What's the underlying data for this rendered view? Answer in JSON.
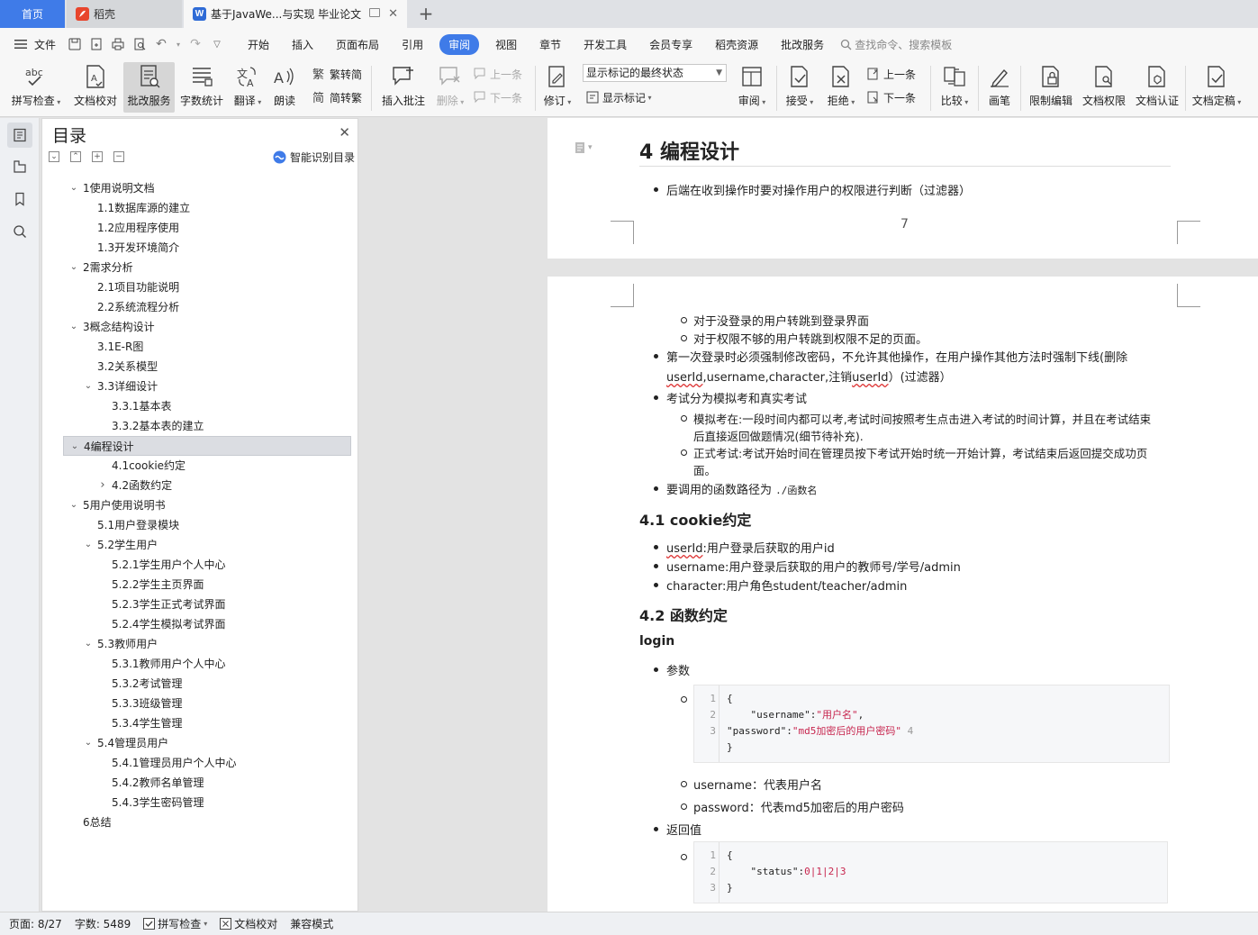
{
  "tabs": {
    "home": "首页",
    "daoke": "稻壳",
    "doc": "基于JavaWe...与实现 毕业论文"
  },
  "menu": [
    "开始",
    "插入",
    "页面布局",
    "引用",
    "审阅",
    "视图",
    "章节",
    "开发工具",
    "会员专享",
    "稻壳资源",
    "批改服务"
  ],
  "menu_active_index": 4,
  "file_label": "文件",
  "search_placeholder": "查找命令、搜索模板",
  "ribbon": {
    "spell": "拼写检查",
    "proof": "文档校对",
    "correct": "批改服务",
    "wordcount": "字数统计",
    "translate": "翻译",
    "read": "朗读",
    "trad": "繁转简",
    "simp": "简转繁",
    "insert_comment": "插入批注",
    "delete": "删除",
    "prev": "上一条",
    "next": "下一条",
    "revise": "修订",
    "markup_select": "显示标记的最终状态",
    "show_markup": "显示标记",
    "review": "审阅",
    "accept": "接受",
    "reject": "拒绝",
    "prev2": "上一条",
    "next2": "下一条",
    "compare": "比较",
    "pen": "画笔",
    "restrict": "限制编辑",
    "perm": "文档权限",
    "auth": "文档认证",
    "final": "文档定稿"
  },
  "toc": {
    "title": "目录",
    "smart": "智能识别目录",
    "items": [
      {
        "label": "1使用说明文档",
        "level": 1,
        "caret": "down"
      },
      {
        "label": "1.1数据库源的建立",
        "level": 2
      },
      {
        "label": "1.2应用程序使用",
        "level": 2
      },
      {
        "label": "1.3开发环境简介",
        "level": 2
      },
      {
        "label": "2需求分析",
        "level": 1,
        "caret": "down"
      },
      {
        "label": "2.1项目功能说明",
        "level": 2
      },
      {
        "label": "2.2系统流程分析",
        "level": 2
      },
      {
        "label": "3概念结构设计",
        "level": 1,
        "caret": "down"
      },
      {
        "label": "3.1E-R图",
        "level": 2
      },
      {
        "label": "3.2关系模型",
        "level": 2
      },
      {
        "label": "3.3详细设计",
        "level": 2,
        "caret": "down"
      },
      {
        "label": "3.3.1基本表",
        "level": 3
      },
      {
        "label": "3.3.2基本表的建立",
        "level": 3
      },
      {
        "label": "4编程设计",
        "level": 1,
        "caret": "down",
        "selected": true
      },
      {
        "label": "4.1cookie约定",
        "level": 3
      },
      {
        "label": "4.2函数约定",
        "level": 3,
        "caret": "right"
      },
      {
        "label": "5用户使用说明书",
        "level": 1,
        "caret": "down"
      },
      {
        "label": "5.1用户登录模块",
        "level": 2
      },
      {
        "label": "5.2学生用户",
        "level": 2,
        "caret": "down"
      },
      {
        "label": "5.2.1学生用户个人中心",
        "level": 3
      },
      {
        "label": "5.2.2学生主页界面",
        "level": 3
      },
      {
        "label": "5.2.3学生正式考试界面",
        "level": 3
      },
      {
        "label": "5.2.4学生模拟考试界面",
        "level": 3
      },
      {
        "label": "5.3教师用户",
        "level": 2,
        "caret": "down"
      },
      {
        "label": "5.3.1教师用户个人中心",
        "level": 3
      },
      {
        "label": "5.3.2考试管理",
        "level": 3
      },
      {
        "label": "5.3.3班级管理",
        "level": 3
      },
      {
        "label": "5.3.4学生管理",
        "level": 3
      },
      {
        "label": "5.4管理员用户",
        "level": 2,
        "caret": "down"
      },
      {
        "label": "5.4.1管理员用户个人中心",
        "level": 3
      },
      {
        "label": "5.4.2教师名单管理",
        "level": 3
      },
      {
        "label": "5.4.3学生密码管理",
        "level": 3
      },
      {
        "label": "6总结",
        "level": 1
      }
    ]
  },
  "page1": {
    "heading": "4 编程设计",
    "bullet": "后端在收到操作时要对操作用户的权限进行判断（过滤器）",
    "page_number": "7"
  },
  "page2": {
    "sub1": "对于没登录的用户转跳到登录界面",
    "sub2": "对于权限不够的用户转跳到权限不足的页面。",
    "b1_line1": "第一次登录时必须强制修改密码，不允许其他操作，在用户操作其他方法时强制下线(删除",
    "b1_l2_a": "userId",
    "b1_l2_b": ",username,character,注销",
    "b1_l2_c": "userId",
    "b1_l2_d": "）(过滤器）",
    "b2": "考试分为模拟考和真实考试",
    "b2_s1_l1": "模拟考在:一段时间内都可以考,考试时间按照考生点击进入考试的时间计算，并且在考试结束",
    "b2_s1_l2": "后直接返回做题情况(细节待补充).",
    "b2_s2_l1": "正式考试:考试开始时间在管理员按下考试开始时统一开始计算，考试结束后返回提交成功页",
    "b2_s2_l2": "面。",
    "b3_text": "要调用的函数路径为",
    "b3_code": "./函数名",
    "h41": "4.1 cookie约定",
    "c1_a": "userId",
    "c1_b": ":用户登录后获取的用户id",
    "c2": "username:用户登录后获取的用户的教师号/学号/admin",
    "c3": "character:用户角色student/teacher/admin",
    "h42": "4.2 函数约定",
    "login": "login",
    "param": "参数",
    "code1": [
      {
        "n": "1",
        "t": "{"
      },
      {
        "n": "2",
        "k": "    \"username\"",
        "s": "\"用户名\"",
        "e": ","
      },
      {
        "n": "3",
        "k": "\"password\"",
        "s": "\"md5加密后的用户密码\"",
        "e": " 4"
      },
      {
        "n": "",
        "t": "}"
      }
    ],
    "p1": "username：代表用户名",
    "p2": "password：代表md5加密后的用户密码",
    "ret": "返回值",
    "code2": [
      {
        "n": "1",
        "t": "{"
      },
      {
        "n": "2",
        "k": "    \"status\"",
        "s": "0|1|2|3",
        "e": ""
      },
      {
        "n": "3",
        "t": "}"
      }
    ]
  },
  "status": {
    "page": "页面: 8/27",
    "words": "字数: 5489",
    "spell": "拼写检查",
    "proof": "文档校对",
    "compat": "兼容模式"
  },
  "colors": {
    "accent": "#3f7be8",
    "wps_red": "#e8452c",
    "wps_blue": "#2f6bd6"
  }
}
